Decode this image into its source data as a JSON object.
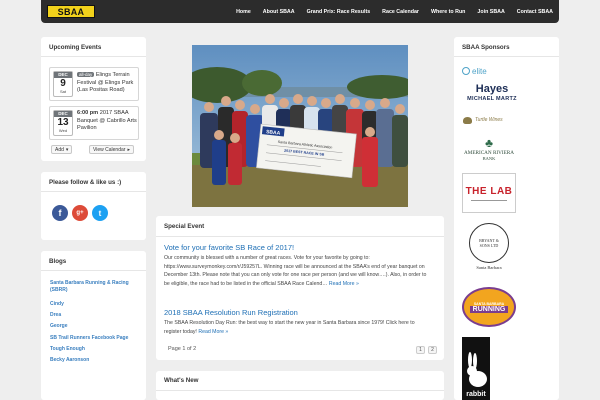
{
  "header": {
    "logo_text": "SBAA",
    "nav": [
      "Home",
      "About SBAA",
      "Grand Prix: Race Results",
      "Race Calendar",
      "Where to Run",
      "Join SBAA",
      "Contact SBAA"
    ]
  },
  "upcoming": {
    "title": "Upcoming Events",
    "events": [
      {
        "month": "DEC",
        "day": "9",
        "weekday": "Sat",
        "badge": "all-day",
        "text": "Elings Terrain Festival @ Elings Park (Las Positas Road)"
      },
      {
        "month": "DEC",
        "day": "13",
        "weekday": "Wed",
        "time": "6:00 pm",
        "text": "2017 SBAA Banquet @ Cabrillo Arts Pavilion"
      }
    ],
    "add_label": "Add",
    "view_label": "View Calendar"
  },
  "social": {
    "title": "Please follow & like us :)",
    "icons": [
      "f",
      "g+",
      "t"
    ]
  },
  "blogs": {
    "title": "Blogs",
    "items": [
      "Santa Barbara Running & Racing (SBRR)",
      "Cindy",
      "Drea",
      "George",
      "SB Trail Runners Facebook Page",
      "Tough Enough",
      "Becky Aaronson"
    ]
  },
  "hero": {
    "banner_brand": "SBAA",
    "banner_text": "2017 BEST RACE IN SB",
    "check_text": "Santa Barbara Athletic Association"
  },
  "special": {
    "title": "Special Event",
    "posts": [
      {
        "title": "Vote for your favorite SB Race of 2017!",
        "body": "Our community is blessed with a number of great races.   Vote for your favorite by going to: https://www.surveymonkey.com/r/J59257L.  Winning race will be announced at the SBAA’s end of year banquet on December 13th.  Please note that you can only vote for one race per person (and we will know….).  Also, in order to be eligible, the race had to be listed in the official SBAA Race Calend…",
        "more": "Read More »"
      },
      {
        "title": "2018 SBAA Resolution Run Registration",
        "body": "The SBAA Resolution Day Run: the best way to start the new year in Santa Barbara since 1979! Click here to register today!",
        "more": "Read More »"
      }
    ],
    "pager_text": "Page 1 of 2",
    "pages": [
      "1",
      "2"
    ]
  },
  "whats_new": {
    "title": "What's New"
  },
  "sponsors": {
    "title": "SBAA Sponsors",
    "logos": [
      {
        "name": "elite-logo",
        "text": "elite"
      },
      {
        "name": "hayes-logo",
        "text": "Hayes",
        "sub": "MICHAEL MARTZ"
      },
      {
        "name": "turtle-logo",
        "text": "Turtle Wines"
      },
      {
        "name": "american-riviera-bank-logo",
        "text": "AMERICAN RIVIERA",
        "sub": "BANK"
      },
      {
        "name": "the-lab-logo",
        "text": "THE LAB"
      },
      {
        "name": "bryant-sons-logo",
        "text": "BRYANT & SONS LTD",
        "sub": "Santa Barbara"
      },
      {
        "name": "sb-running-logo",
        "text": "RUNNING",
        "sub": "SANTA BARBARA"
      },
      {
        "name": "rabbit-logo",
        "text": "rabbit"
      }
    ]
  },
  "colors": {
    "header_bg": "#2c2c2c",
    "logo_bg": "#f2d21b",
    "link": "#1e6fb5",
    "blog_link": "#3a7fbf",
    "page_bg": "#eeeeee"
  }
}
